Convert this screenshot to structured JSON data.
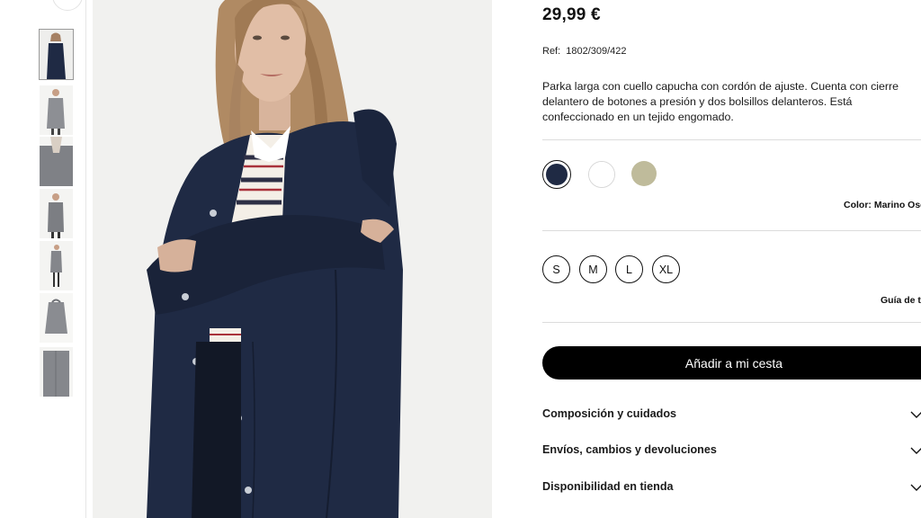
{
  "product": {
    "price": "29,99 €",
    "ref_label": "Ref:",
    "ref_value": "1802/309/422",
    "description": "Parka larga con cuello capucha con cordón de ajuste. Cuenta con cierre delantero de botones a presión y dos bolsillos delanteros. Está confeccionado en un tejido engomado."
  },
  "colors": {
    "swatches": [
      {
        "name": "navy-swatch",
        "hex": "#1f2a44"
      },
      {
        "name": "white-swatch",
        "hex": "#ffffff"
      },
      {
        "name": "khaki-swatch",
        "hex": "#bfbb9b"
      }
    ],
    "label_prefix": "Color:",
    "selected": "Marino Oscuro"
  },
  "sizes": {
    "options": [
      "S",
      "M",
      "L",
      "XL"
    ],
    "guide_label": "Guía de tallas"
  },
  "actions": {
    "add_to_cart": "Añadir a mi cesta"
  },
  "accordions": [
    {
      "label": "Composición y cuidados"
    },
    {
      "label": "Envíos, cambios y devoluciones"
    },
    {
      "label": "Disponibilidad en tienda"
    }
  ],
  "thumbnails": {
    "count": 7,
    "active_index": 0,
    "icons": [
      "parka-navy-photo",
      "parka-grey-front-photo",
      "parka-grey-detail-photo",
      "parka-grey-model-photo",
      "parka-grey-full-photo",
      "parka-grey-flat-photo",
      "parka-grey-closeup-photo"
    ]
  },
  "style": {
    "accent": "#000000",
    "divider": "#dcdcdc",
    "parka_navy": "#1f2a44"
  }
}
